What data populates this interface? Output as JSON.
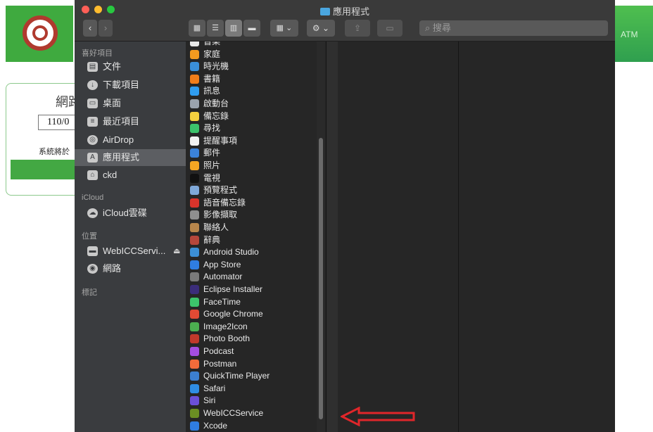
{
  "window": {
    "title": "應用程式"
  },
  "toolbar": {
    "view_group_icon": "view-mode-icons",
    "arrange_icon": "arrange-icon",
    "action_icon": "gear-icon",
    "share_icon": "share-icon",
    "tag_icon": "tag-icon"
  },
  "search": {
    "placeholder": "搜尋"
  },
  "sidebar": {
    "favorites_header": "喜好項目",
    "favorites": [
      {
        "label": "文件",
        "icon": "document-icon"
      },
      {
        "label": "下載項目",
        "icon": "download-icon"
      },
      {
        "label": "桌面",
        "icon": "desktop-icon"
      },
      {
        "label": "最近項目",
        "icon": "recents-icon"
      },
      {
        "label": "AirDrop",
        "icon": "airdrop-icon"
      },
      {
        "label": "應用程式",
        "icon": "applications-icon",
        "selected": true
      },
      {
        "label": "ckd",
        "icon": "home-icon"
      }
    ],
    "icloud_header": "iCloud",
    "icloud": [
      {
        "label": "iCloud雲碟",
        "icon": "cloud-icon"
      }
    ],
    "locations_header": "位置",
    "locations": [
      {
        "label": "WebICCServi...",
        "icon": "disk-icon",
        "eject": "⏏"
      },
      {
        "label": "網路",
        "icon": "network-icon"
      }
    ],
    "tags_header": "標記"
  },
  "apps": [
    {
      "label": "音樂",
      "color": "#e8e8e8"
    },
    {
      "label": "家庭",
      "color": "#f29a1f"
    },
    {
      "label": "時光機",
      "color": "#3a8fd9"
    },
    {
      "label": "書籍",
      "color": "#f07d1a"
    },
    {
      "label": "訊息",
      "color": "#2f9df0"
    },
    {
      "label": "啟動台",
      "color": "#9aa3ad"
    },
    {
      "label": "備忘錄",
      "color": "#f4d03f"
    },
    {
      "label": "尋找",
      "color": "#3cc36b"
    },
    {
      "label": "提醒事項",
      "color": "#f2f2f2"
    },
    {
      "label": "郵件",
      "color": "#3b82d9"
    },
    {
      "label": "照片",
      "color": "#f5a623"
    },
    {
      "label": "電視",
      "color": "#111111"
    },
    {
      "label": "預覽程式",
      "color": "#7fa8d8"
    },
    {
      "label": "語音備忘錄",
      "color": "#d9342b"
    },
    {
      "label": "影像擷取",
      "color": "#8f8f8f"
    },
    {
      "label": "聯絡人",
      "color": "#b8864b"
    },
    {
      "label": "辭典",
      "color": "#b5473b"
    },
    {
      "label": "Android Studio",
      "color": "#3c8fd4"
    },
    {
      "label": "App Store",
      "color": "#2f7de1"
    },
    {
      "label": "Automator",
      "color": "#7a7a7a"
    },
    {
      "label": "Eclipse Installer",
      "color": "#3b2d7a"
    },
    {
      "label": "FaceTime",
      "color": "#3cc36b"
    },
    {
      "label": "Google Chrome",
      "color": "#e24a34"
    },
    {
      "label": "Image2Icon",
      "color": "#4caf50"
    },
    {
      "label": "Photo Booth",
      "color": "#c0392b"
    },
    {
      "label": "Podcast",
      "color": "#a44de0"
    },
    {
      "label": "Postman",
      "color": "#f26b3a"
    },
    {
      "label": "QuickTime Player",
      "color": "#3c7fd0"
    },
    {
      "label": "Safari",
      "color": "#2f8de4"
    },
    {
      "label": "Siri",
      "color": "#6b4fd8"
    },
    {
      "label": "WebICCService",
      "color": "#6b8e23"
    },
    {
      "label": "Xcode",
      "color": "#2f7de1"
    }
  ],
  "background_page": {
    "card_title": "網路",
    "date_input": "110/0",
    "note": "系統將於"
  },
  "colors": {
    "annotation_arrow": "#e0262a"
  }
}
